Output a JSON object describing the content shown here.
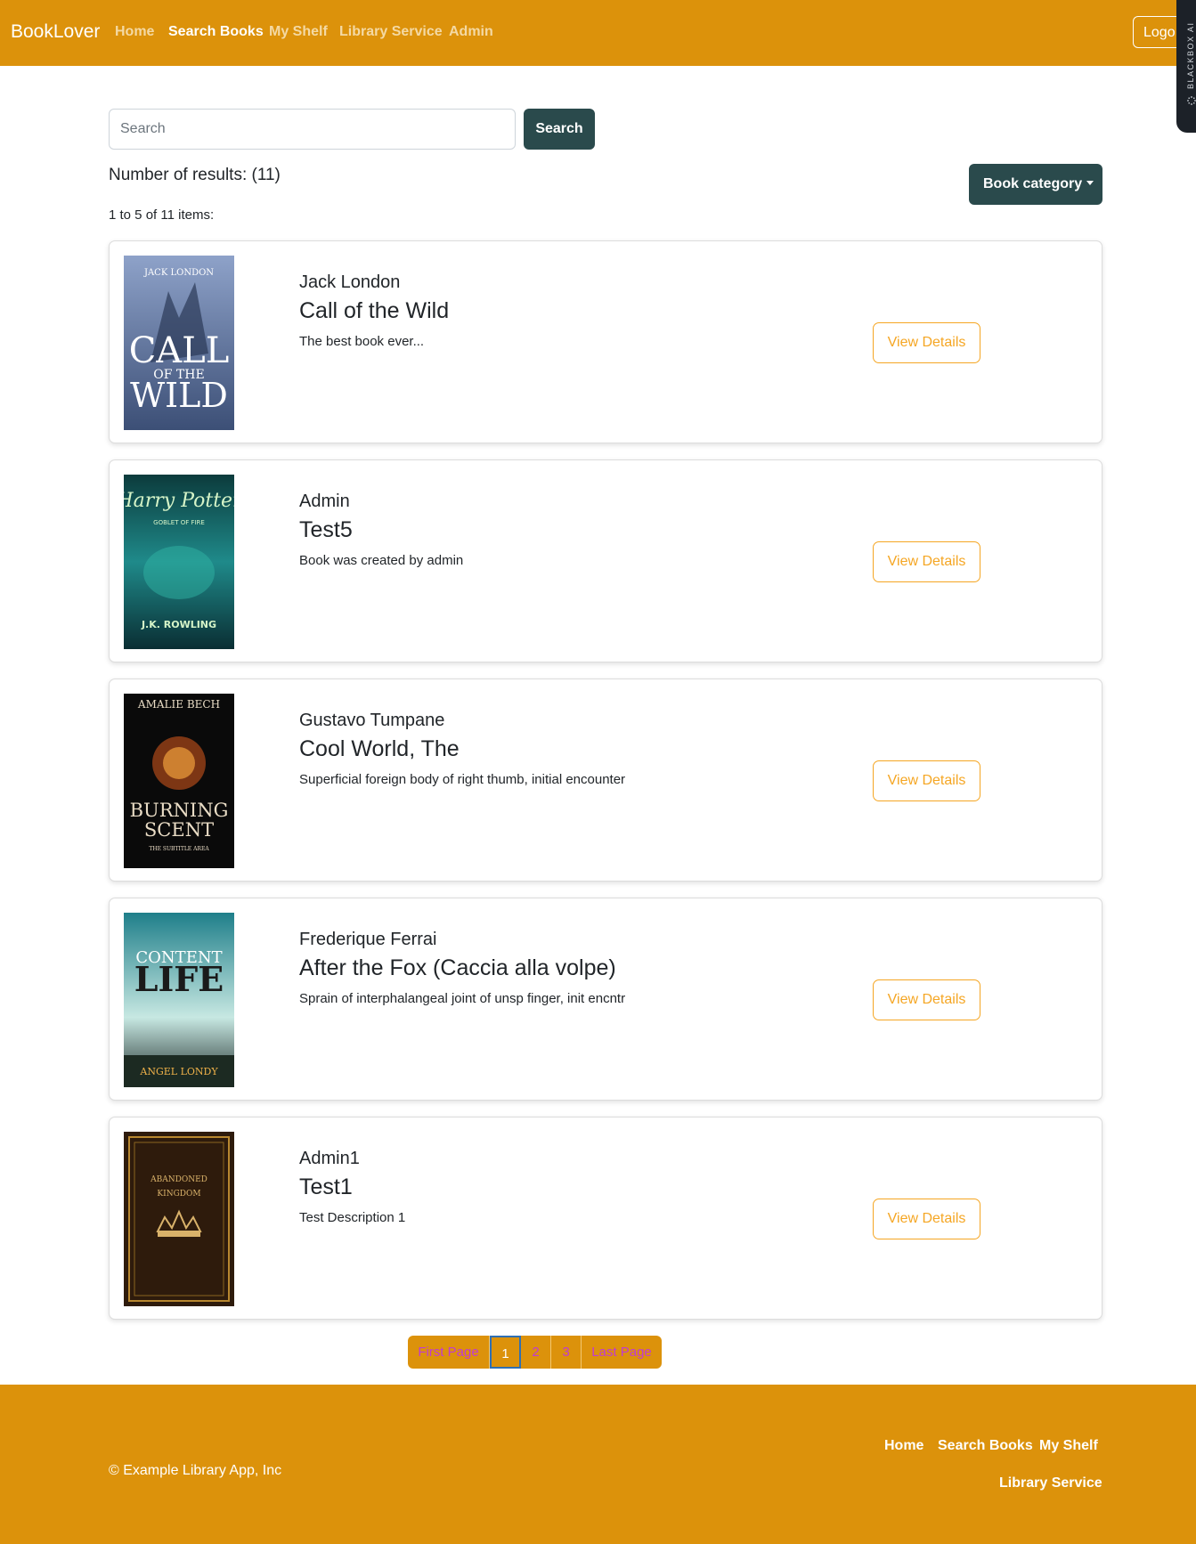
{
  "navbar": {
    "brand": "BookLover",
    "links": [
      {
        "label": "Home",
        "active": false
      },
      {
        "label": "Search Books",
        "active": true
      },
      {
        "label": "My Shelf",
        "active": false
      },
      {
        "label": "Library Service",
        "active": false
      },
      {
        "label": "Admin",
        "active": false
      }
    ],
    "logout_label": "Logo",
    "side_tab_label": "BLACKBOX AI"
  },
  "search": {
    "placeholder": "Search",
    "button_label": "Search"
  },
  "results": {
    "count_text": "Number of results: (11)",
    "range_text": "1 to 5 of 11 items:",
    "category_button": "Book category"
  },
  "books": [
    {
      "author": "Jack London",
      "title": "Call of the Wild",
      "description": "The best book ever...",
      "button": "View Details",
      "cover": {
        "top": "JACK LONDON",
        "main": "CALL OF THE WILD",
        "bottom": "",
        "colors": [
          "#3c4f76",
          "#8ea2c9"
        ],
        "text_color": "#ffffff"
      }
    },
    {
      "author": "Admin",
      "title": "Test5",
      "description": "Book was created by admin",
      "button": "View Details",
      "cover": {
        "top": "Harry Potter",
        "main": "GOBLET OF FIRE",
        "bottom": "J.K. ROWLING",
        "colors": [
          "#0c3b3c",
          "#1f8a8a"
        ],
        "text_color": "#d6f4c8"
      }
    },
    {
      "author": "Gustavo Tumpane",
      "title": "Cool World, The",
      "description": "Superficial foreign body of right thumb, initial encounter",
      "button": "View Details",
      "cover": {
        "top": "AMALIE BECH",
        "main": "BURNING SCENT",
        "bottom": "THE SUBTITLE AREA",
        "colors": [
          "#0a0a0a",
          "#3a2210"
        ],
        "text_color": "#e9dcc5"
      }
    },
    {
      "author": "Frederique Ferrai",
      "title": "After the Fox (Caccia alla volpe)",
      "description": "Sprain of interphalangeal joint of unsp finger, init encntr",
      "button": "View Details",
      "cover": {
        "top": "CONTENT",
        "main": "LIFE",
        "bottom": "ANGEL LONDY",
        "colors": [
          "#1f7f8a",
          "#c7e8e2"
        ],
        "text_color": "#1a1a1a"
      }
    },
    {
      "author": "Admin1",
      "title": "Test1",
      "description": "Test Description 1",
      "button": "View Details",
      "cover": {
        "top": "ABANDONED",
        "main": "KINGDOM",
        "bottom": "",
        "colors": [
          "#2e1b0c",
          "#4a2e14"
        ],
        "text_color": "#d9b26a"
      }
    }
  ],
  "pagination": {
    "first": "First Page",
    "pages": [
      "1",
      "2",
      "3"
    ],
    "current": "1",
    "last": "Last Page"
  },
  "footer": {
    "copyright": "© Example Library App, Inc",
    "links": [
      "Home",
      "Search Books",
      "My Shelf",
      "Library Service"
    ]
  },
  "colors": {
    "brand": "#dc920b",
    "dark_button": "#2a4a4c",
    "accent_outline": "#f5a623"
  }
}
